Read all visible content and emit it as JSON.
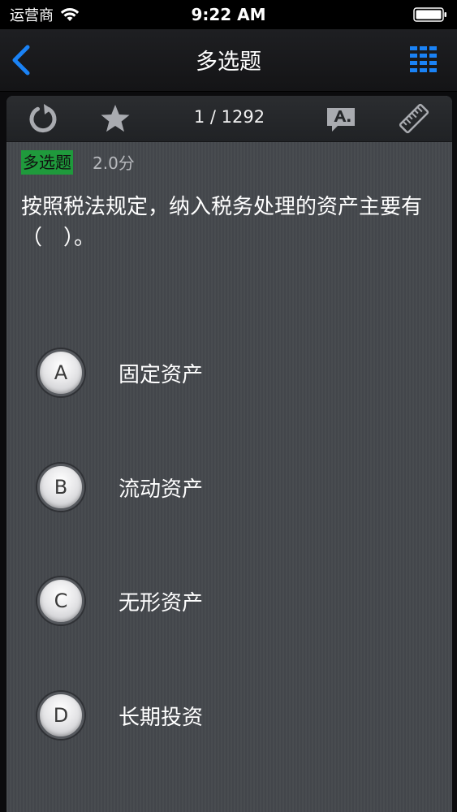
{
  "status_bar": {
    "carrier": "运营商",
    "time": "9:22 AM"
  },
  "nav": {
    "title": "多选题"
  },
  "toolbar": {
    "counter": "1 / 1292"
  },
  "question": {
    "type": "多选题",
    "score": "2.0分",
    "text": "按照税法规定，纳入税务处理的资产主要有（　）。",
    "options": [
      {
        "letter": "A",
        "text": "固定资产"
      },
      {
        "letter": "B",
        "text": "流动资产"
      },
      {
        "letter": "C",
        "text": "无形资产"
      },
      {
        "letter": "D",
        "text": "长期投资"
      }
    ]
  },
  "colors": {
    "accent": "#1a82f5",
    "badge": "#1f9a3c"
  }
}
